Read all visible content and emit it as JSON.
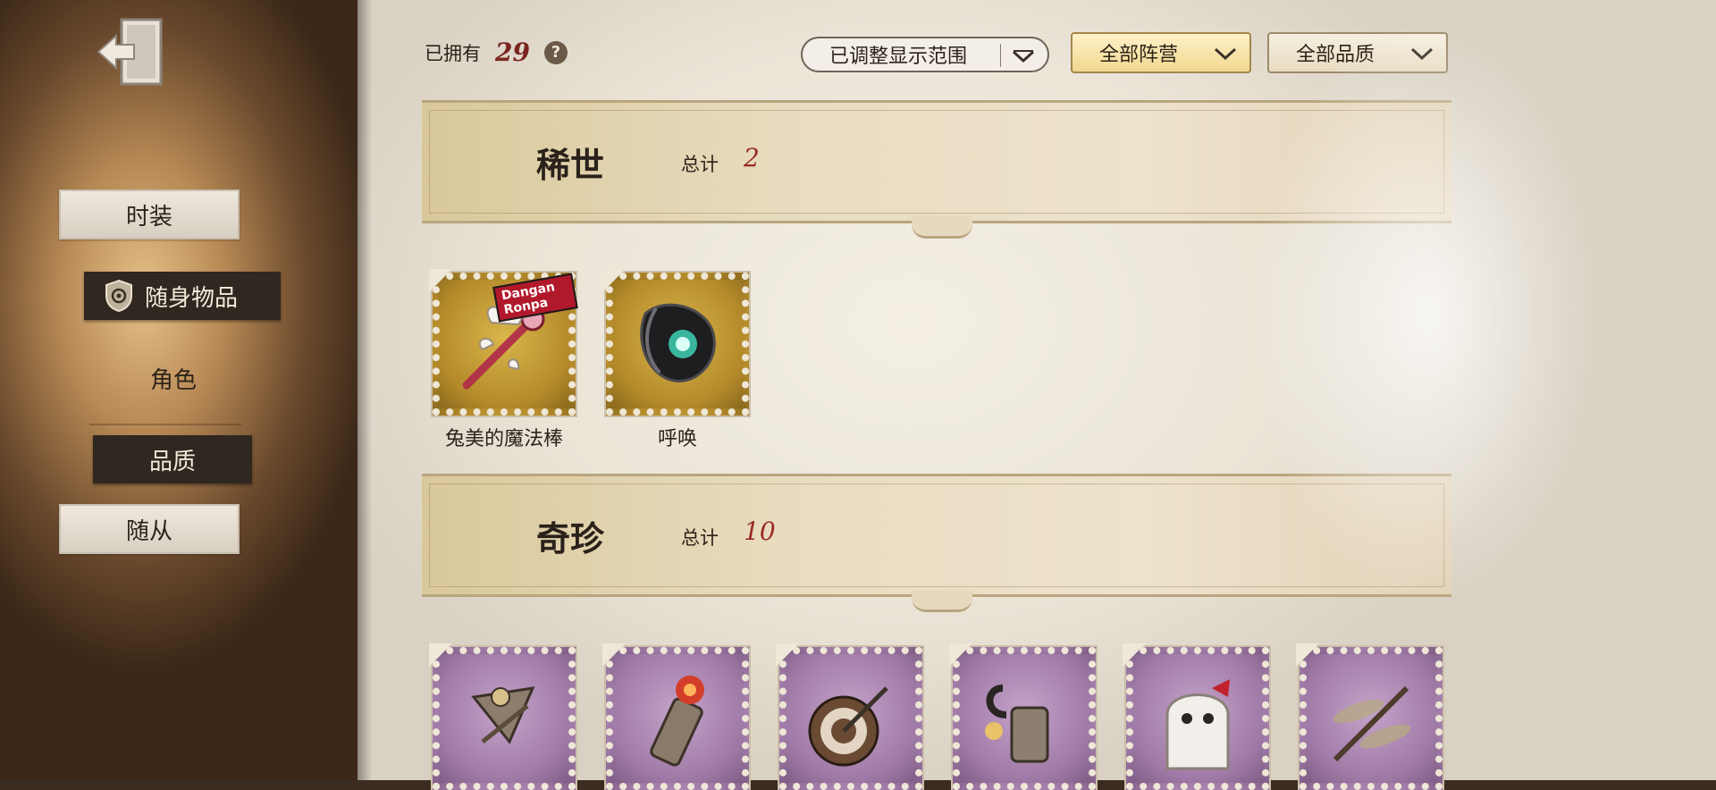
{
  "sidebar": {
    "items": [
      {
        "label": "时装",
        "state": "paper"
      },
      {
        "label": "随身物品",
        "state": "selected"
      },
      {
        "label": "角色",
        "state": "plain"
      },
      {
        "label": "品质",
        "state": "dark"
      },
      {
        "label": "随从",
        "state": "paper"
      }
    ]
  },
  "header": {
    "owned_label": "已拥有",
    "owned_count": "29",
    "help_glyph": "?",
    "filter_range": "已调整显示范围",
    "filter_camp": "全部阵营",
    "filter_quality": "全部品质"
  },
  "sections": [
    {
      "title": "稀世",
      "total_label": "总计",
      "total_value": "2",
      "items": [
        {
          "name": "兔美的魔法棒",
          "icon": "magic-wand-icon",
          "frame": "gold",
          "badge": "Dangan Ronpa"
        },
        {
          "name": "呼唤",
          "icon": "summon-orb-icon",
          "frame": "gold"
        }
      ]
    },
    {
      "title": "奇珍",
      "total_label": "总计",
      "total_value": "10",
      "items": [
        {
          "icon": "crossbow-lantern-icon",
          "frame": "purple"
        },
        {
          "icon": "red-bottle-icon",
          "frame": "purple"
        },
        {
          "icon": "target-pin-icon",
          "frame": "purple"
        },
        {
          "icon": "hook-icon",
          "frame": "purple"
        },
        {
          "icon": "ghost-doll-icon",
          "frame": "purple"
        },
        {
          "icon": "dragonfly-icon",
          "frame": "purple"
        }
      ]
    }
  ],
  "colors": {
    "accent_red": "#9b2a22",
    "gold_frame": "#b48a2a",
    "purple_frame": "#9f7aa6",
    "selected_tab": "#2f2720"
  }
}
